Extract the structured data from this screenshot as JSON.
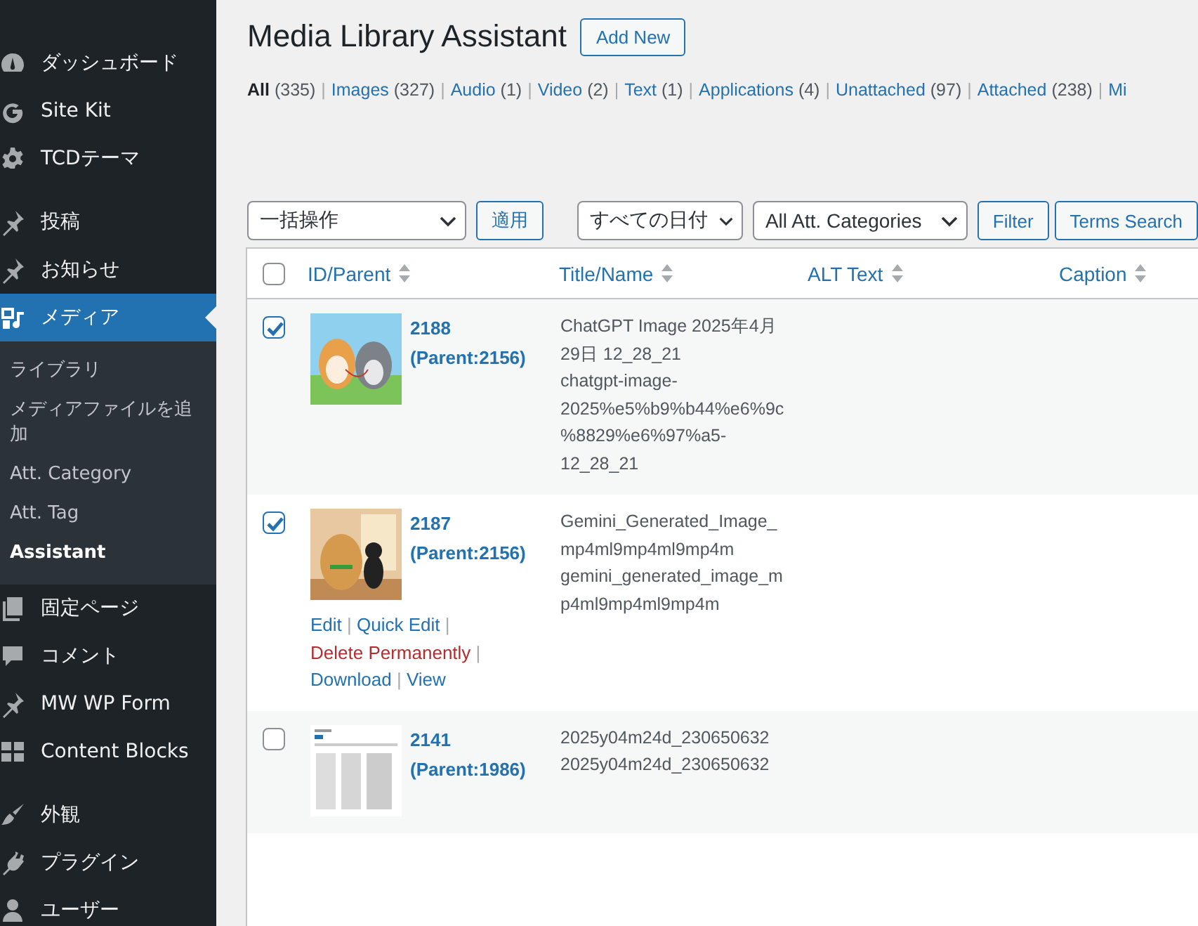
{
  "sidebar": {
    "groups": [
      [
        {
          "label": "ダッシュボード",
          "selected": false
        },
        {
          "label": "Site Kit",
          "selected": false
        },
        {
          "label": "TCDテーマ",
          "selected": false
        }
      ],
      [
        {
          "label": "投稿",
          "selected": false
        },
        {
          "label": "お知らせ",
          "selected": false
        },
        {
          "label": "メディア",
          "selected": true,
          "children": [
            {
              "label": "ライブラリ",
              "selected": false
            },
            {
              "label": "メディアファイルを追加",
              "selected": false
            },
            {
              "label": "Att. Category",
              "selected": false
            },
            {
              "label": "Att. Tag",
              "selected": false
            },
            {
              "label": "Assistant",
              "selected": true
            }
          ]
        },
        {
          "label": "固定ページ",
          "selected": false
        },
        {
          "label": "コメント",
          "selected": false
        },
        {
          "label": "MW WP Form",
          "selected": false
        },
        {
          "label": "Content Blocks",
          "selected": false
        }
      ],
      [
        {
          "label": "外観",
          "selected": false
        },
        {
          "label": "プラグイン",
          "selected": false
        },
        {
          "label": "ユーザー",
          "selected": false
        }
      ]
    ]
  },
  "header": {
    "title": "Media Library Assistant",
    "add_new": "Add New"
  },
  "filters": {
    "separator": "|",
    "items": [
      {
        "label": "All",
        "count": "(335)",
        "selected": true
      },
      {
        "label": "Images",
        "count": "(327)",
        "selected": false
      },
      {
        "label": "Audio",
        "count": "(1)",
        "selected": false
      },
      {
        "label": "Video",
        "count": "(2)",
        "selected": false
      },
      {
        "label": "Text",
        "count": "(1)",
        "selected": false
      },
      {
        "label": "Applications",
        "count": "(4)",
        "selected": false
      },
      {
        "label": "Unattached",
        "count": "(97)",
        "selected": false
      },
      {
        "label": "Attached",
        "count": "(238)",
        "selected": false
      },
      {
        "label": "Mi",
        "selected": false
      }
    ]
  },
  "toolbar": {
    "bulk_action": "一括操作",
    "apply": "適用",
    "date": "すべての日付",
    "category": "All Att. Categories",
    "filter": "Filter",
    "terms_search": "Terms Search"
  },
  "table": {
    "select_all_checked": false,
    "columns": [
      "ID/Parent",
      "Title/Name",
      "ALT Text",
      "Caption"
    ],
    "action_separator": "|",
    "rows": [
      {
        "checked": true,
        "id": "2188",
        "parent": "(Parent:2156)",
        "title": "ChatGPT Image 2025年4月29日 12_28_21",
        "name": "chatgpt-image-2025%e5%b9%b44%e6%9c%8829%e6%97%a5-12_28_21"
      },
      {
        "checked": true,
        "id": "2187",
        "parent": "(Parent:2156)",
        "title": "Gemini_Generated_Image_mp4ml9mp4ml9mp4m",
        "name": "gemini_generated_image_mp4ml9mp4ml9mp4m",
        "actions": [
          {
            "label": "Edit",
            "kind": "link"
          },
          {
            "label": "Quick Edit",
            "kind": "link"
          },
          {
            "label": "Delete Permanently",
            "kind": "delete"
          },
          {
            "label": "Download",
            "kind": "link"
          },
          {
            "label": "View",
            "kind": "link"
          }
        ]
      },
      {
        "checked": false,
        "id": "2141",
        "parent": "(Parent:1986)",
        "title": "2025y04m24d_230650632",
        "name": "2025y04m24d_230650632"
      }
    ]
  }
}
